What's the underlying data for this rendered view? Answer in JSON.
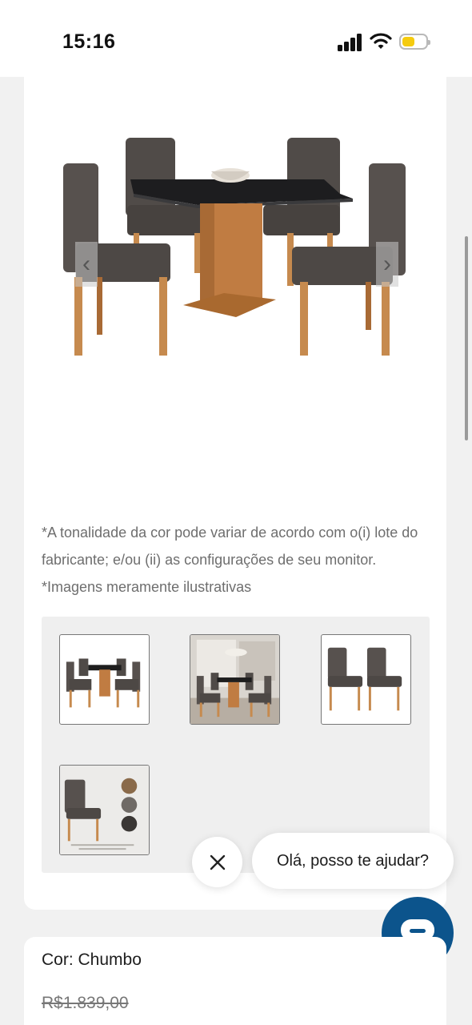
{
  "status_bar": {
    "time": "15:16",
    "signal_icon": "cellular-signal-icon",
    "wifi_icon": "wifi-icon",
    "battery_icon": "battery-low-icon",
    "battery_color": "#f5cb0f"
  },
  "product": {
    "main_image_alt": "dining-table-set-image",
    "prev_icon": "chevron-left-icon",
    "next_icon": "chevron-right-icon",
    "disclaimer": "*A tonalidade da cor pode variar de acordo com o(i) lote do fabricante; e/ou (ii) as configurações de seu monitor. *Imagens meramente ilustrativas",
    "thumbnails": [
      {
        "name": "thumb-table-set"
      },
      {
        "name": "thumb-room-scene"
      },
      {
        "name": "thumb-two-chairs"
      },
      {
        "name": "thumb-chair-details"
      }
    ]
  },
  "chat": {
    "close_icon": "close-icon",
    "greeting": "Olá, posso te ajudar?",
    "launcher_icon": "chat-icon",
    "launcher_color": "#0c548c"
  },
  "price": {
    "color_label": "Cor: Chumbo",
    "old_price": "R$1.839,00"
  }
}
